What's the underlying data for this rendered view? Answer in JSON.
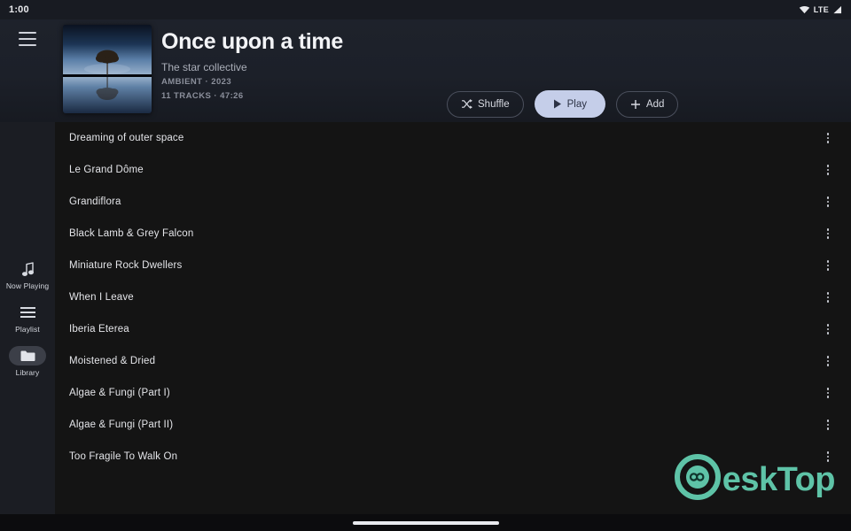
{
  "status_bar": {
    "time": "1:00",
    "network_label": "LTE",
    "wifi_icon": "wifi-icon",
    "signal_icon": "signal-bars-icon"
  },
  "header": {
    "menu_icon": "hamburger-menu-icon",
    "album_art_alt": "tree-reflection-album-art",
    "title": "Once upon a time",
    "artist": "The star collective",
    "genre_year": "AMBIENT · 2023",
    "tracks_duration": "11 TRACKS · 47:26"
  },
  "actions": {
    "shuffle_label": "Shuffle",
    "shuffle_icon": "shuffle-icon",
    "play_label": "Play",
    "play_icon": "play-triangle-icon",
    "add_label": "Add",
    "add_icon": "plus-icon",
    "play_button_color": "#c5cee9"
  },
  "sidebar": {
    "items": [
      {
        "label": "Now Playing",
        "icon": "music-note-icon",
        "active": false
      },
      {
        "label": "Playlist",
        "icon": "list-lines-icon",
        "active": false
      },
      {
        "label": "Library",
        "icon": "folder-icon",
        "active": true
      }
    ]
  },
  "tracklist": {
    "overflow_icon": "kebab-menu-icon",
    "tracks": [
      {
        "title": "Dreaming of outer space"
      },
      {
        "title": "Le Grand Dôme"
      },
      {
        "title": "Grandiflora"
      },
      {
        "title": "Black Lamb & Grey Falcon"
      },
      {
        "title": "Miniature Rock Dwellers"
      },
      {
        "title": "When I Leave"
      },
      {
        "title": "Iberia Eterea"
      },
      {
        "title": "Moistened & Dried"
      },
      {
        "title": "Algae & Fungi (Part I)"
      },
      {
        "title": "Algae & Fungi (Part II)"
      },
      {
        "title": "Too Fragile To Walk On"
      }
    ]
  },
  "watermark": {
    "text": "eskTop",
    "logo_icon": "desktop-d-logo-icon",
    "color": "#5ec3a7"
  },
  "navbar": {
    "home_indicator": "home-indicator"
  }
}
